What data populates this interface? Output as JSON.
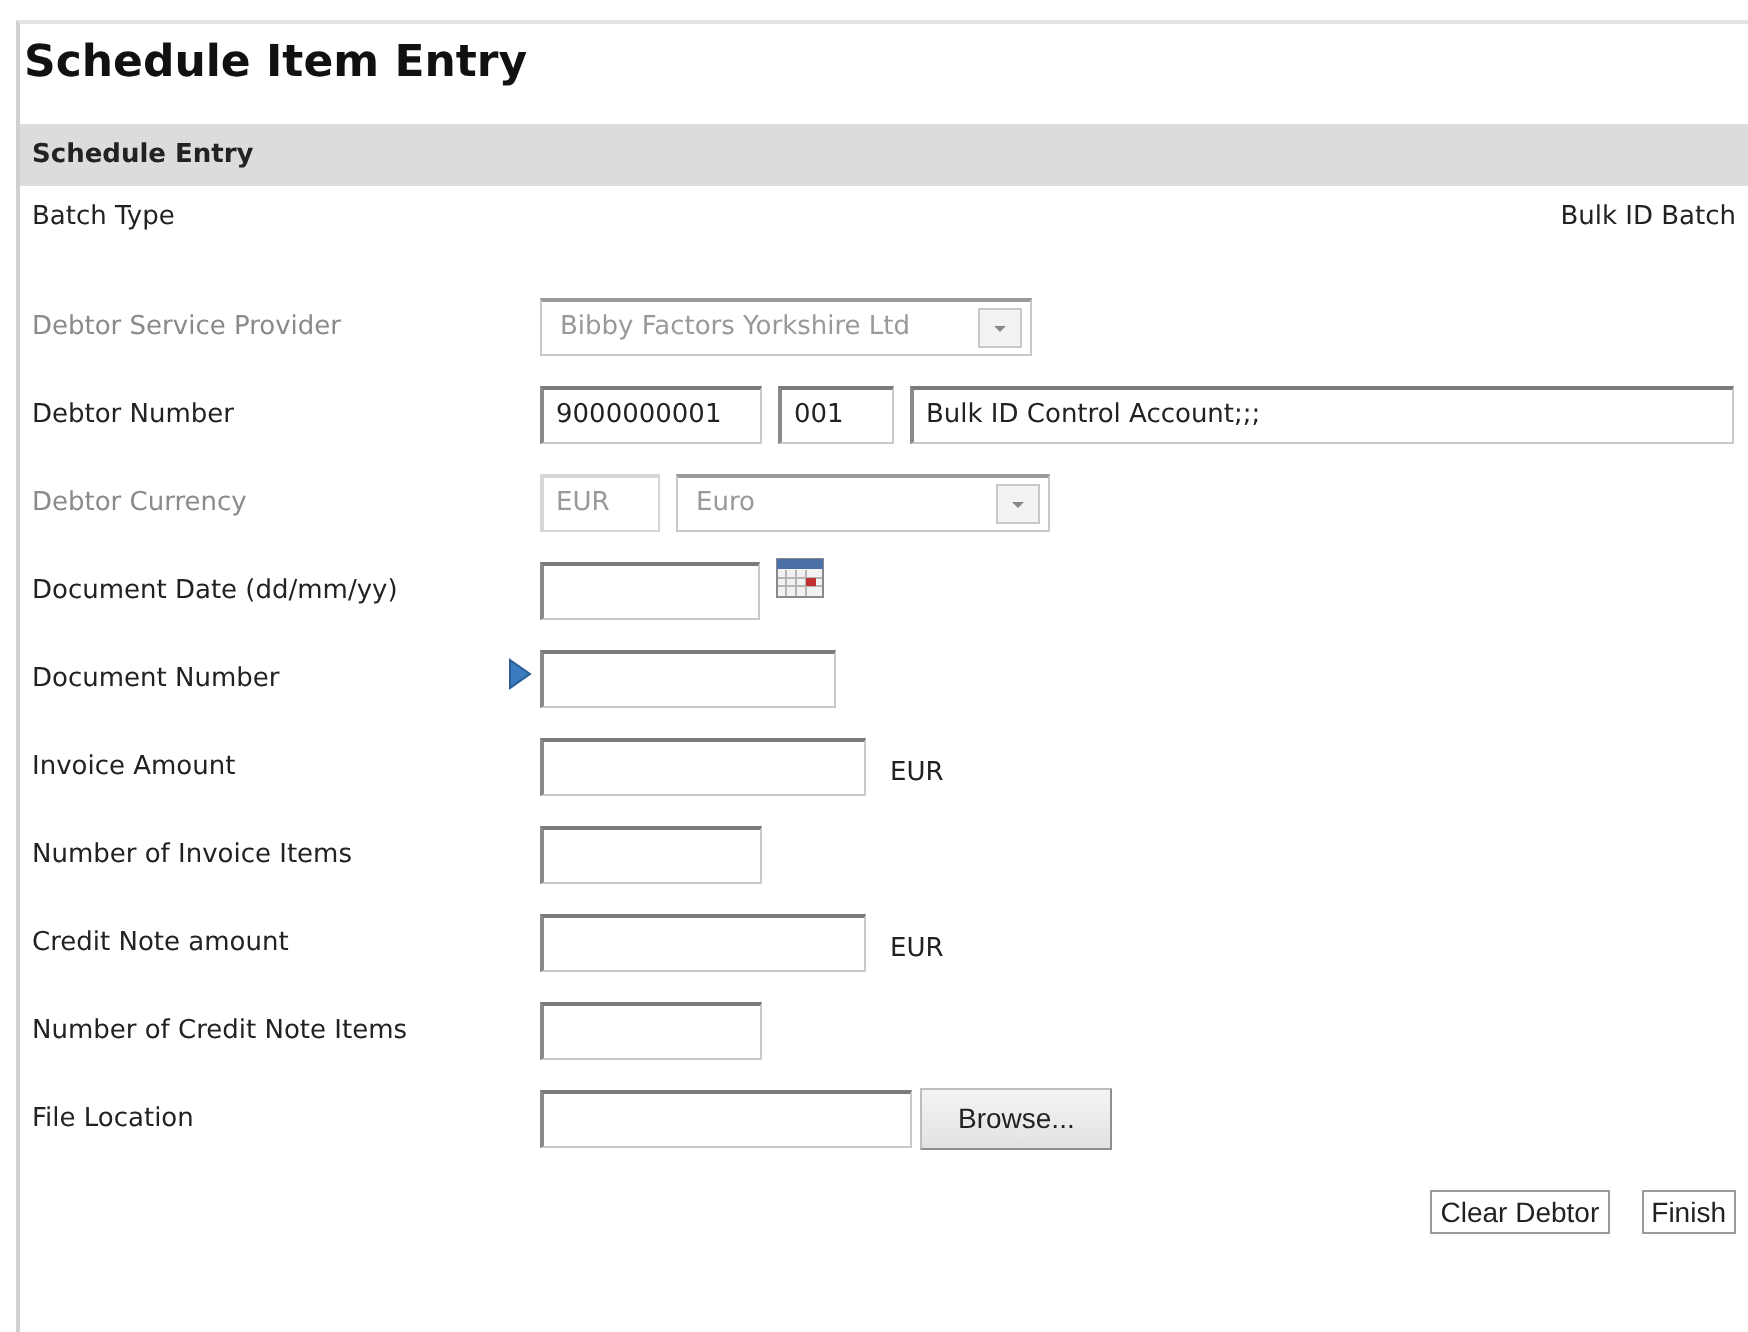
{
  "title": "Schedule Item Entry",
  "section": {
    "title": "Schedule Entry"
  },
  "batch_type": {
    "label": "Batch Type",
    "value": "Bulk ID Batch"
  },
  "rows": [
    {
      "label": "Debtor Service Provider",
      "disabled": true,
      "current": false,
      "controls": [
        {
          "kind": "select",
          "value": "Bibby Factors Yorkshire Ltd"
        }
      ]
    },
    {
      "label": "Debtor Number",
      "disabled": false,
      "current": false,
      "controls": [
        {
          "kind": "text",
          "value": "9000000001"
        },
        {
          "kind": "text",
          "value": "001"
        },
        {
          "kind": "text",
          "value": "Bulk ID Control Account;;;"
        }
      ]
    },
    {
      "label": "Debtor Currency",
      "disabled": true,
      "current": false,
      "controls": [
        {
          "kind": "text",
          "value": "EUR"
        },
        {
          "kind": "select",
          "value": "Euro"
        }
      ]
    },
    {
      "label": "Document Date (dd/mm/yy)",
      "disabled": false,
      "current": false,
      "controls": [
        {
          "kind": "text"
        },
        {
          "kind": "calendar"
        }
      ]
    },
    {
      "label": "Document Number",
      "disabled": false,
      "current": true,
      "controls": [
        {
          "kind": "text"
        }
      ]
    },
    {
      "label": "Invoice Amount",
      "disabled": false,
      "current": false,
      "controls": [
        {
          "kind": "text"
        },
        {
          "kind": "suffix",
          "value": "EUR"
        }
      ]
    },
    {
      "label": "Number of Invoice Items",
      "disabled": false,
      "current": false,
      "controls": [
        {
          "kind": "text"
        }
      ]
    },
    {
      "label": "Credit Note amount",
      "disabled": false,
      "current": false,
      "controls": [
        {
          "kind": "text"
        },
        {
          "kind": "suffix",
          "value": "EUR"
        }
      ]
    },
    {
      "label": "Number of Credit Note Items",
      "disabled": false,
      "current": false,
      "controls": [
        {
          "kind": "text"
        }
      ]
    },
    {
      "label": "File Location",
      "disabled": false,
      "current": false,
      "controls": [
        {
          "kind": "text"
        },
        {
          "kind": "browse",
          "value": "Browse..."
        }
      ]
    }
  ],
  "buttons": [
    "Clear Debtor",
    "Finish"
  ]
}
